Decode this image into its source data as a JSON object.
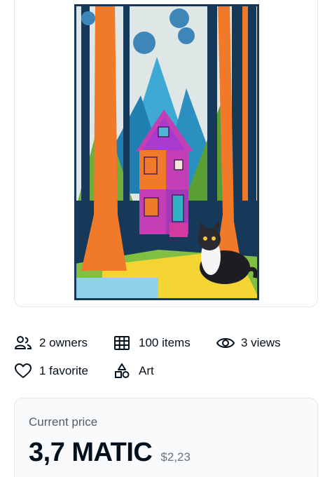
{
  "nft": {
    "image_alt": "Illustration of a purple house in a forest with a cat",
    "stats": {
      "owners": "2 owners",
      "items": "100 items",
      "views": "3 views",
      "favorites": "1 favorite",
      "category": "Art"
    },
    "icons": {
      "owners": "people-icon",
      "items": "grid-icon",
      "views": "eye-icon",
      "favorites": "heart-icon",
      "category": "shapes-icon"
    }
  },
  "price": {
    "label": "Current price",
    "amount": "3,7 MATIC",
    "usd": "$2,23"
  },
  "colors": {
    "text": "#04111d",
    "muted": "#545d66",
    "border": "#e5e8eb",
    "price_bg": "#f9fafb"
  }
}
